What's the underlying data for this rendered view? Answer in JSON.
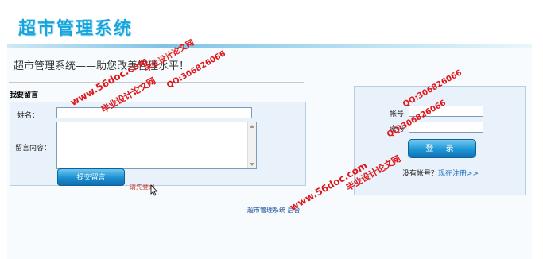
{
  "header": {
    "title": "超市管理系统"
  },
  "slogan": "超市管理系统——助您改善管理水平！",
  "message_form": {
    "section_title": "我要留言",
    "name_label": "姓名：",
    "name_value": "",
    "content_label": "留言内容：",
    "content_value": "",
    "submit_label": "提交留言",
    "login_hint": "请先登录"
  },
  "login_form": {
    "account_label": "帐号",
    "password_label": "密码",
    "account_value": "",
    "password_value": "",
    "login_label": "登 录",
    "no_account_text": "没有帐号？",
    "register_link": "现在注册>>"
  },
  "footer": {
    "text": "超市管理系统 后台"
  },
  "watermarks": {
    "site": "www.56doc.com",
    "name": "毕业设计论文网",
    "qq": "QQ:306826066"
  },
  "colors": {
    "brand": "#16a4dd",
    "button": "#1a8fd0",
    "watermark": "#e1161b",
    "link": "#1f6fc0"
  }
}
